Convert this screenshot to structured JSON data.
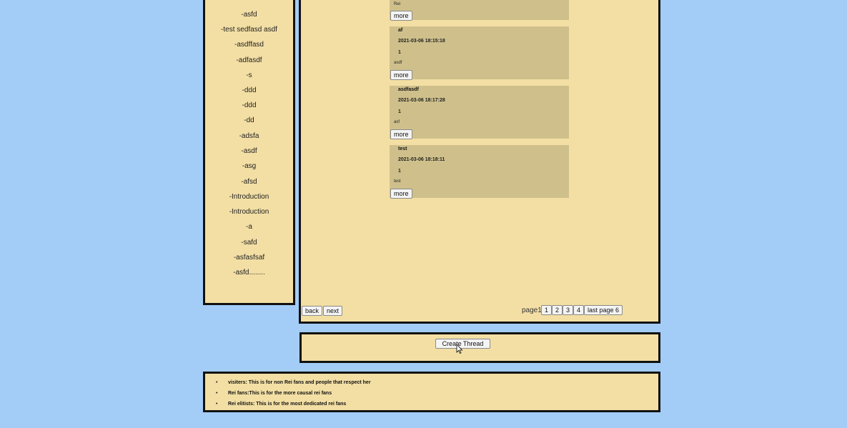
{
  "sidebar": {
    "items": [
      "-asfd",
      "-test sedfasd asdf",
      "-asdffasd",
      "-adfasdf",
      "-s",
      "-ddd",
      "-ddd",
      "-dd",
      "-adsfa",
      "-asdf",
      "-asg",
      "-afsd",
      "-Introduction",
      "-Introduction",
      "-a",
      "-safd",
      "-asfasfsaf",
      "-asfd........"
    ]
  },
  "threads": [
    {
      "title": "",
      "date": "",
      "count": "",
      "body": "Rei",
      "more_label": "more"
    },
    {
      "title": "af",
      "date": "2021-03-06 18:15:18",
      "count": "1",
      "body": "asdf",
      "more_label": "more"
    },
    {
      "title": "asdfasdf",
      "date": "2021-03-06 18:17:28",
      "count": "1",
      "body": "asf",
      "more_label": "more"
    },
    {
      "title": "test",
      "date": "2021-03-06 18:18:11",
      "count": "1",
      "body": "test",
      "more_label": "more"
    }
  ],
  "pagination": {
    "back_label": "back",
    "next_label": "next",
    "page_label": "page1",
    "pages": [
      "1",
      "2",
      "3",
      "4"
    ],
    "last_label": "last page 6"
  },
  "create_thread_label": "Create Thread",
  "roles": [
    "visiters: This is for non Rei fans and people that respect her",
    "Rei fans:This is for the more causal rei fans",
    "Rei elitists: This is for the most dedicated rei fans"
  ]
}
